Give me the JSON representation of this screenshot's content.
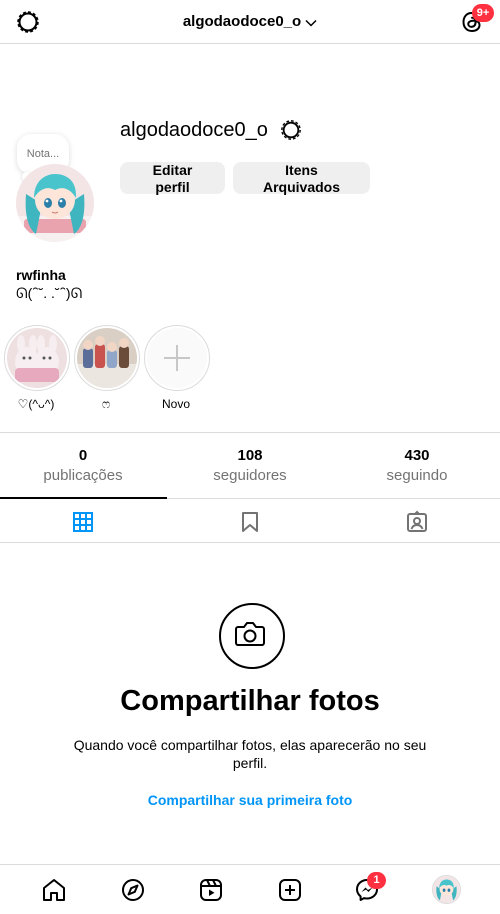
{
  "header": {
    "username": "algodaodoce0_o",
    "notification_badge": "9+",
    "icons": [
      "settings-icon",
      "chevron-down-icon",
      "threads-icon"
    ]
  },
  "profile": {
    "username": "algodaodoce0_o",
    "note_placeholder": "Nota...",
    "edit_button": "Editar perfil",
    "archive_button": "Itens Arquivados",
    "full_name": "rwfinha",
    "bio": "ᘏ(ᐢ˘. .˘ᐢ)ᘏ"
  },
  "highlights": [
    {
      "label": "♡(^ᴗ^)"
    },
    {
      "label": "ෆ"
    },
    {
      "label": "Novo"
    }
  ],
  "stats": [
    {
      "value": "0",
      "label": "publicações"
    },
    {
      "value": "108",
      "label": "seguidores"
    },
    {
      "value": "430",
      "label": "seguindo"
    }
  ],
  "tabs": [
    "grid-icon",
    "bookmark-icon",
    "tagged-icon"
  ],
  "empty_state": {
    "title": "Compartilhar fotos",
    "description": "Quando você compartilhar fotos, elas aparecerão no seu perfil.",
    "link": "Compartilhar sua primeira foto"
  },
  "bottom_nav": {
    "items": [
      "home-icon",
      "explore-icon",
      "reels-icon",
      "create-icon",
      "messenger-icon",
      "profile-avatar"
    ],
    "messages_badge": "1"
  },
  "colors": {
    "accent": "#0095f6",
    "badge": "#ff3040",
    "border": "#dbdbdb",
    "secondary_text": "#737373"
  }
}
